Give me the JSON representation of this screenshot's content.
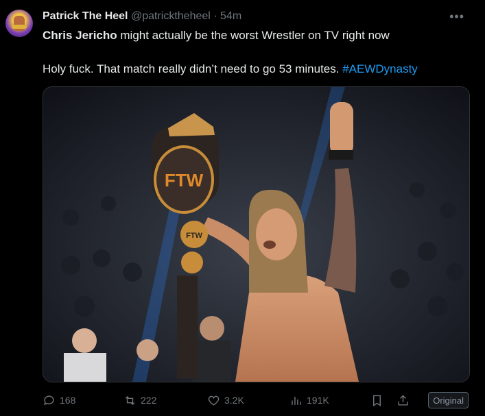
{
  "tweet": {
    "author_name": "Patrick The Heel",
    "author_handle": "@patricktheheel",
    "separator": "·",
    "time": "54m",
    "more_icon": "more-horizontal-icon",
    "line1_bold": "Chris Jericho",
    "line1_rest": " might actually be the worst Wrestler on TV right now",
    "line2_text": "Holy fuck. That match really didn’t need to go 53 minutes. ",
    "hashtag": "#AEWDynasty"
  },
  "actions": {
    "replies": "168",
    "reposts": "222",
    "likes": "3.2K",
    "views": "191K",
    "original_label": "Original"
  },
  "colors": {
    "background": "#000000",
    "text": "#e7e9ea",
    "muted": "#71767b",
    "link": "#1d9bf0"
  }
}
